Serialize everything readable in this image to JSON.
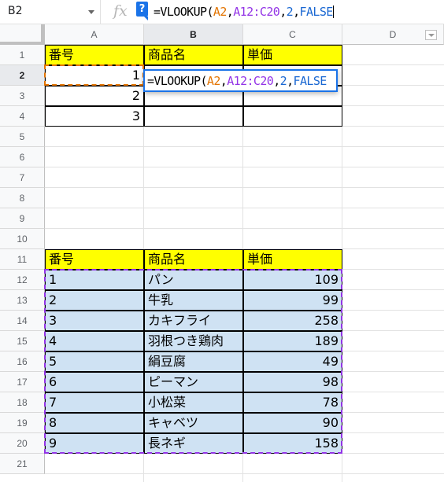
{
  "namebox": {
    "value": "B2"
  },
  "formula_bar": {
    "fx": "fx",
    "help": "?",
    "tokens": [
      {
        "text": "=VLOOKUP(",
        "kind": "plain"
      },
      {
        "text": "A2",
        "kind": "a"
      },
      {
        "text": ",",
        "kind": "plain"
      },
      {
        "text": "A12:C20",
        "kind": "b"
      },
      {
        "text": ",",
        "kind": "plain"
      },
      {
        "text": "2",
        "kind": "n2"
      },
      {
        "text": ",",
        "kind": "plain"
      },
      {
        "text": "FALSE",
        "kind": "k"
      }
    ]
  },
  "columns": [
    "A",
    "B",
    "C",
    "D"
  ],
  "rows": [
    "1",
    "2",
    "3",
    "4",
    "5",
    "6",
    "7",
    "8",
    "9",
    "10",
    "11",
    "12",
    "13",
    "14",
    "15",
    "16",
    "17",
    "18",
    "19",
    "20",
    "21"
  ],
  "selected": {
    "column": "B",
    "row": "2"
  },
  "colors": {
    "header_fill": "#ffff00",
    "range_fill": "#cfe2f3",
    "range_a_border": "#e37400",
    "range_b_border": "#9334e6",
    "editor_border": "#1a73e8"
  },
  "lookup_table": {
    "headers": [
      "番号",
      "商品名",
      "単価"
    ],
    "rows": [
      {
        "a": "1",
        "b": "",
        "c": ""
      },
      {
        "a": "2",
        "b": "",
        "c": ""
      },
      {
        "a": "3",
        "b": "",
        "c": ""
      }
    ]
  },
  "master_table": {
    "headers": [
      "番号",
      "商品名",
      "単価"
    ],
    "rows": [
      {
        "a": "1",
        "b": "パン",
        "c": "109"
      },
      {
        "a": "2",
        "b": "牛乳",
        "c": "99"
      },
      {
        "a": "3",
        "b": "カキフライ",
        "c": "258"
      },
      {
        "a": "4",
        "b": "羽根つき鶏肉",
        "c": "189"
      },
      {
        "a": "5",
        "b": "絹豆腐",
        "c": "49"
      },
      {
        "a": "6",
        "b": "ピーマン",
        "c": "98"
      },
      {
        "a": "7",
        "b": "小松菜",
        "c": "78"
      },
      {
        "a": "8",
        "b": "キャベツ",
        "c": "90"
      },
      {
        "a": "9",
        "b": "長ネギ",
        "c": "158"
      }
    ]
  }
}
